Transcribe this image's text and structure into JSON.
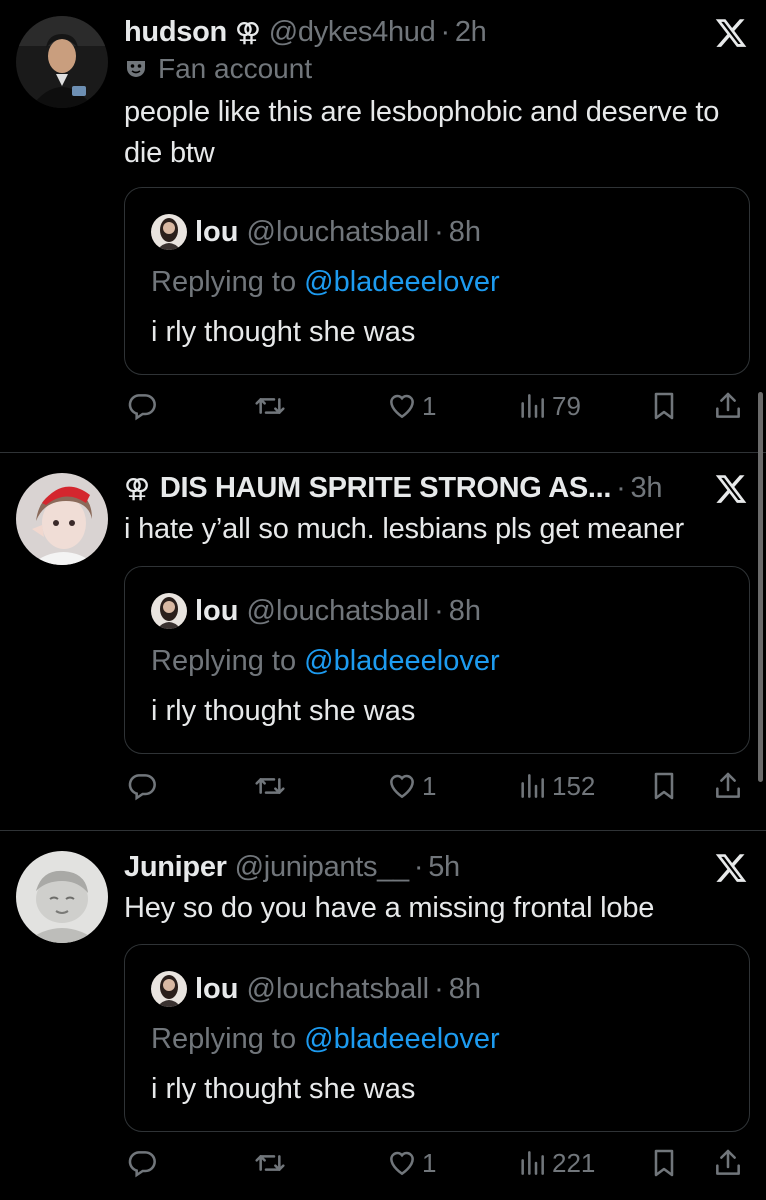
{
  "colors": {
    "background": "#000000",
    "text": "#e7e9ea",
    "muted": "#71767b",
    "link": "#1d9bf0",
    "divider": "#2f3336"
  },
  "tweets": [
    {
      "name": "hudson",
      "name_symbol": "⚢",
      "handle": "@dykes4hud",
      "separator": "·",
      "time": "2h",
      "badge_label": "Fan account",
      "text": "people like this are lesbophobic and deserve to die btw",
      "quote": {
        "name": "lou",
        "handle": "@louchatsball",
        "separator": "·",
        "time": "8h",
        "replying_prefix": "Replying to",
        "replying_mention": "@bladeeelover",
        "text": "i rly thought she was"
      },
      "likes": "1",
      "views": "79"
    },
    {
      "name": "DIS HAUM SPRITE STRONG AS...",
      "name_symbol": "⚢",
      "handle": "",
      "separator": "·",
      "time": "3h",
      "text": "i hate y’all so much. lesbians pls get meaner",
      "quote": {
        "name": "lou",
        "handle": "@louchatsball",
        "separator": "·",
        "time": "8h",
        "replying_prefix": "Replying to",
        "replying_mention": "@bladeeelover",
        "text": "i rly thought she was"
      },
      "likes": "1",
      "views": "152"
    },
    {
      "name": "Juniper",
      "handle": "@junipants__",
      "separator": "·",
      "time": "5h",
      "text": "Hey so do you have a missing frontal lobe",
      "quote": {
        "name": "lou",
        "handle": "@louchatsball",
        "separator": "·",
        "time": "8h",
        "replying_prefix": "Replying to",
        "replying_mention": "@bladeeelover",
        "text": "i rly thought she was"
      },
      "likes": "1",
      "views": "221"
    }
  ],
  "icons": [
    "x-logo-icon",
    "theater-mask-icon",
    "reply-icon",
    "retweet-icon",
    "heart-icon",
    "views-icon",
    "bookmark-icon",
    "share-icon"
  ]
}
